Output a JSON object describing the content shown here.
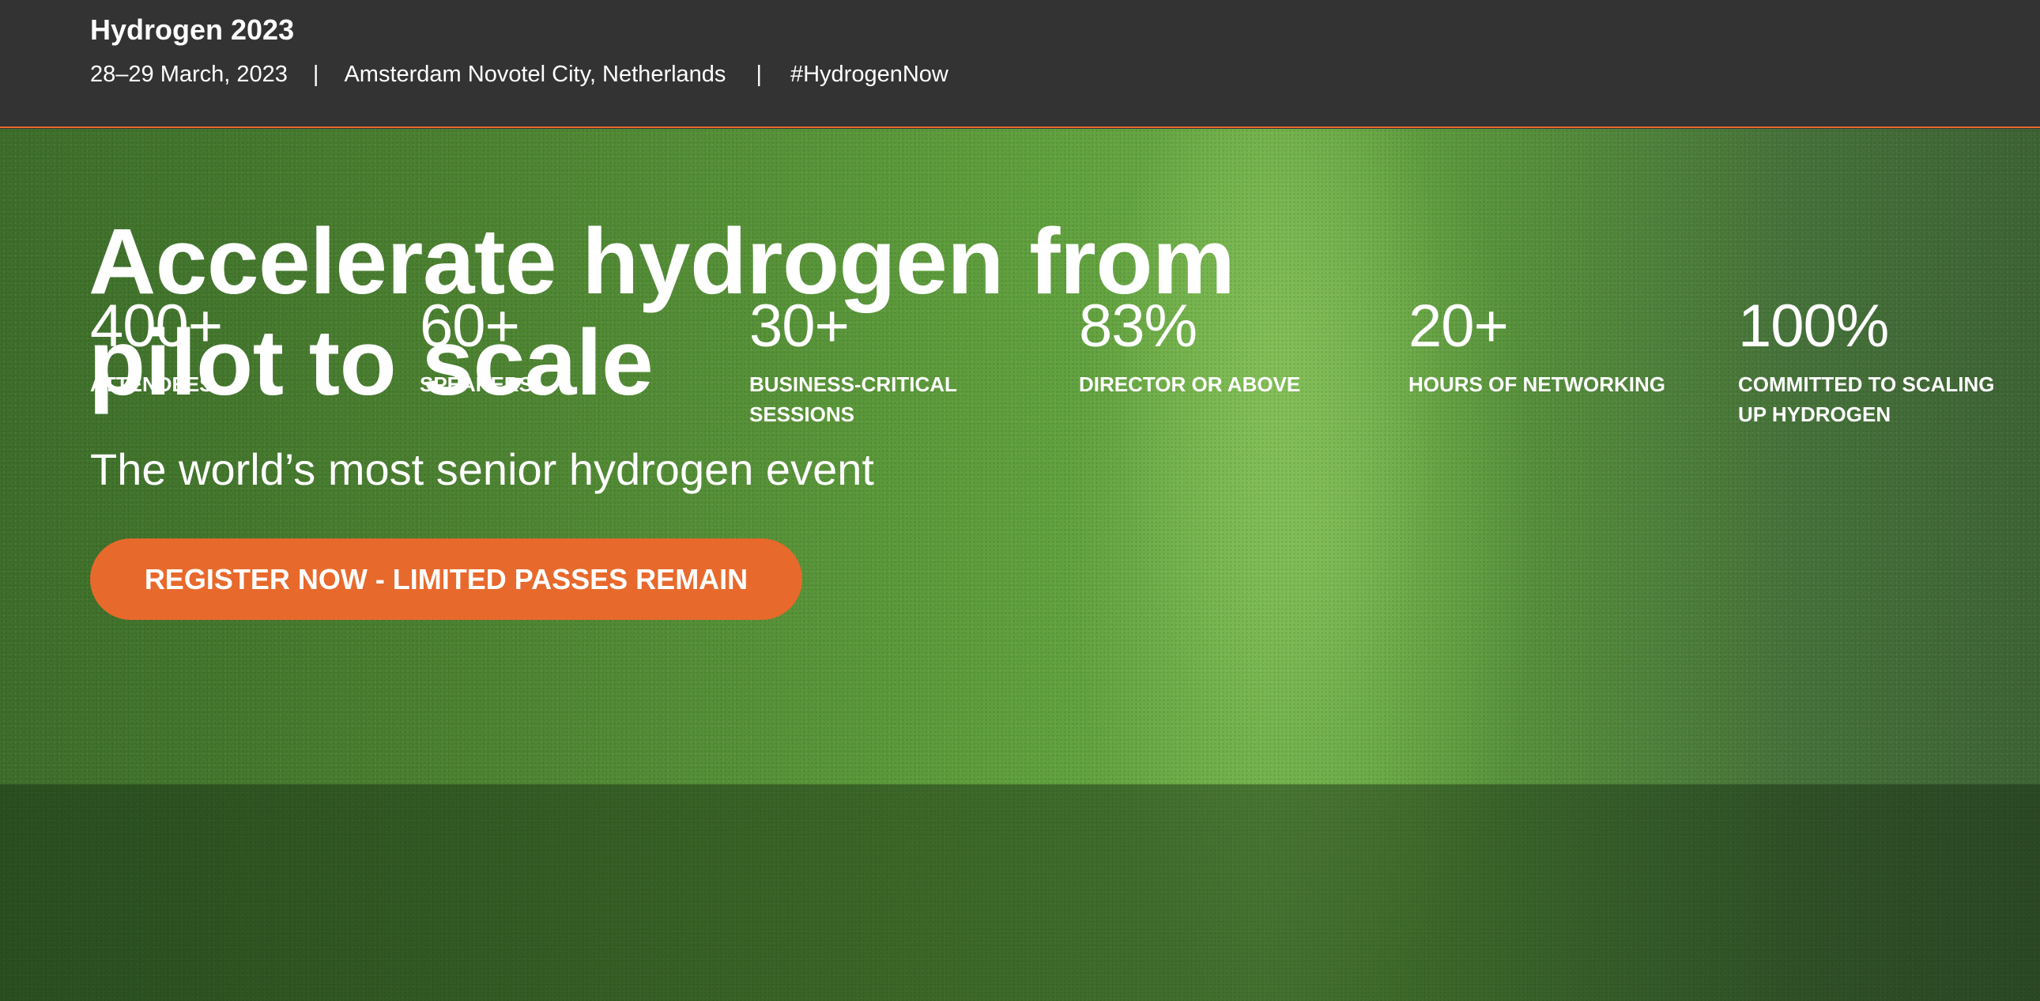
{
  "header": {
    "event_name": "Hydrogen 2023",
    "dates": "28–29 March, 2023",
    "separator": "|",
    "location": "Amsterdam Novotel City, Netherlands",
    "hashtag": "#HydrogenNow"
  },
  "hero": {
    "headline": "Accelerate hydrogen from pilot to scale",
    "subheadline": "The world’s most senior hydrogen event",
    "cta_label": "REGISTER NOW - LIMITED PASSES REMAIN"
  },
  "stats": [
    {
      "value": "400+",
      "label": "ATTENDEES"
    },
    {
      "value": "60+",
      "label": "SPEAKERS"
    },
    {
      "value": "30+",
      "label": "BUSINESS-CRITICAL SESSIONS"
    },
    {
      "value": "83%",
      "label": "DIRECTOR OR ABOVE"
    },
    {
      "value": "20+",
      "label": "HOURS OF NETWORKING"
    },
    {
      "value": "100%",
      "label": "COMMITTED TO SCALING UP HYDROGEN"
    }
  ],
  "colors": {
    "header_bg": "#333333",
    "accent": "#e8692c",
    "hero_green": "#5c9a3b",
    "text": "#ffffff"
  }
}
